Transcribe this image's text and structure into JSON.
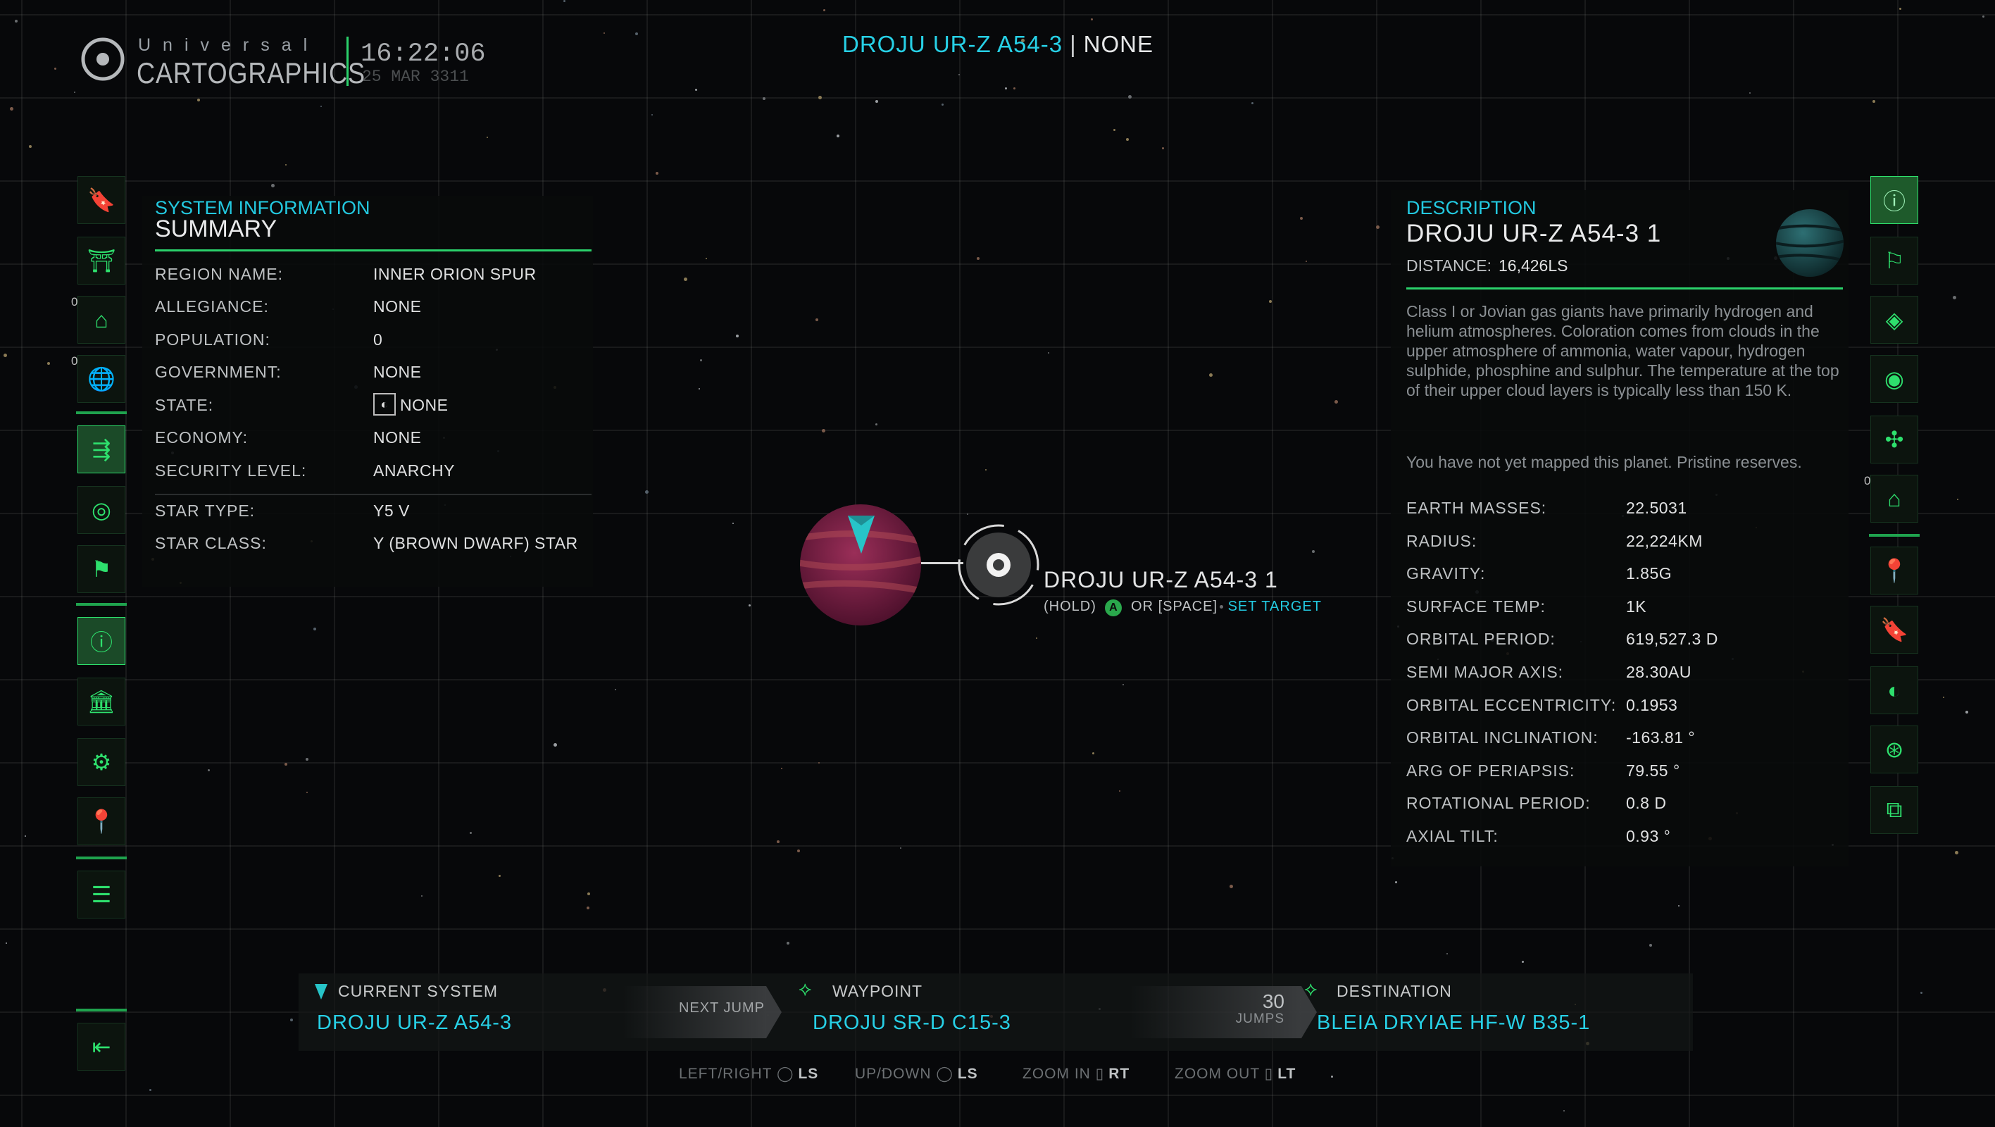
{
  "header": {
    "logo_small": "Universal",
    "logo_big": "CARTOGRAPHICS",
    "time": "16:22:06",
    "date": "25 MAR 3311",
    "system_name": "DROJU UR-Z A54-3",
    "separator": "|",
    "system_status": "NONE"
  },
  "left_icons": [
    {
      "name": "bookmark-icon",
      "glyph": "🔖"
    },
    {
      "name": "blueprint-icon",
      "glyph": "⛩"
    },
    {
      "name": "landable-icon",
      "glyph": "⌂",
      "badge": "0"
    },
    {
      "name": "world-icon",
      "glyph": "🌐",
      "badge": "0"
    },
    {
      "name": "route-icon",
      "glyph": "⇶"
    },
    {
      "name": "globe-filter-icon",
      "glyph": "◎"
    },
    {
      "name": "flag-icon",
      "glyph": "⚑"
    },
    {
      "name": "info-icon",
      "glyph": "ⓘ"
    },
    {
      "name": "bank-icon",
      "glyph": "🏛"
    },
    {
      "name": "settings-icon",
      "glyph": "⚙"
    },
    {
      "name": "pin-icon",
      "glyph": "📍"
    },
    {
      "name": "list-icon",
      "glyph": "☰"
    },
    {
      "name": "exit-icon",
      "glyph": "⇤"
    }
  ],
  "right_icons": [
    {
      "name": "info-eye-icon",
      "glyph": "ⓘ"
    },
    {
      "name": "flag-station-icon",
      "glyph": "⚐"
    },
    {
      "name": "asteroid-icon",
      "glyph": "◈"
    },
    {
      "name": "target-icon",
      "glyph": "◉"
    },
    {
      "name": "orbit-icon",
      "glyph": "✣"
    },
    {
      "name": "landable-planet-icon",
      "glyph": "⌂",
      "badge": "0"
    },
    {
      "name": "location-icon",
      "glyph": "📍"
    },
    {
      "name": "bookmark-add-icon",
      "glyph": "🔖"
    },
    {
      "name": "moon-icon",
      "glyph": "◐"
    },
    {
      "name": "network-icon",
      "glyph": "⊛"
    },
    {
      "name": "copy-icon",
      "glyph": "⧉"
    }
  ],
  "system_info": {
    "pre_title": "SYSTEM INFORMATION",
    "title": "SUMMARY",
    "rows": [
      {
        "label": "REGION NAME:",
        "value": "INNER ORION SPUR"
      },
      {
        "label": "ALLEGIANCE:",
        "value": "NONE"
      },
      {
        "label": "POPULATION:",
        "value": "0"
      },
      {
        "label": "GOVERNMENT:",
        "value": "NONE"
      },
      {
        "label": "STATE:",
        "value": "NONE"
      },
      {
        "label": "ECONOMY:",
        "value": "NONE"
      },
      {
        "label": "SECURITY LEVEL:",
        "value": "ANARCHY"
      }
    ],
    "star_rows": [
      {
        "label": "STAR TYPE:",
        "value": "Y5 V"
      },
      {
        "label": "STAR CLASS:",
        "value": "Y (BROWN DWARF) STAR"
      }
    ]
  },
  "description": {
    "pre_title": "DESCRIPTION",
    "title": "DROJU UR-Z A54-3 1",
    "distance_label": "DISTANCE:",
    "distance_value": "16,426LS",
    "text": "Class I or Jovian gas giants have primarily hydrogen and helium atmospheres. Coloration comes from clouds in the upper atmosphere of ammonia, water vapour, hydrogen sulphide, phosphine and sulphur. The temperature at the top of their upper cloud layers is typically less than 150 K.",
    "note": "You have not yet mapped this planet. Pristine reserves.",
    "stats": [
      {
        "label": "EARTH MASSES:",
        "value": "22.5031"
      },
      {
        "label": "RADIUS:",
        "value": "22,224KM"
      },
      {
        "label": "GRAVITY:",
        "value": "1.85G"
      },
      {
        "label": "SURFACE TEMP:",
        "value": "1K"
      },
      {
        "label": "ORBITAL PERIOD:",
        "value": "619,527.3 D"
      },
      {
        "label": "SEMI MAJOR AXIS:",
        "value": "28.30AU"
      },
      {
        "label": "ORBITAL ECCENTRICITY:",
        "value": "0.1953"
      },
      {
        "label": "ORBITAL INCLINATION:",
        "value": "-163.81 °"
      },
      {
        "label": "ARG OF PERIAPSIS:",
        "value": "79.55 °"
      },
      {
        "label": "ROTATIONAL PERIOD:",
        "value": "0.8 D"
      },
      {
        "label": "AXIAL TILT:",
        "value": "0.93 °"
      }
    ]
  },
  "map": {
    "body_label": "DROJU UR-Z A54-3 1",
    "hint_hold": "(HOLD)",
    "hint_button": "A",
    "hint_or": "OR [SPACE]",
    "hint_action": "SET TARGET"
  },
  "route": {
    "current_label": "CURRENT SYSTEM",
    "current_value": "DROJU UR-Z A54-3",
    "next_jump_label": "NEXT JUMP",
    "waypoint_label": "WAYPOINT",
    "waypoint_value": "DROJU SR-D C15-3",
    "jumps_count": "30",
    "jumps_label": "JUMPS",
    "destination_label": "DESTINATION",
    "destination_value": "BLEIA DRYIAE HF-W B35-1"
  },
  "controls": [
    {
      "label": "LEFT/RIGHT",
      "key": "LS"
    },
    {
      "label": "UP/DOWN",
      "key": "LS"
    },
    {
      "label": "ZOOM IN",
      "key": "RT"
    },
    {
      "label": "ZOOM OUT",
      "key": "LT"
    }
  ],
  "colors": {
    "accent_cyan": "#27d0e6",
    "accent_green": "#2ee06d",
    "planet": "#8a1f4a"
  }
}
